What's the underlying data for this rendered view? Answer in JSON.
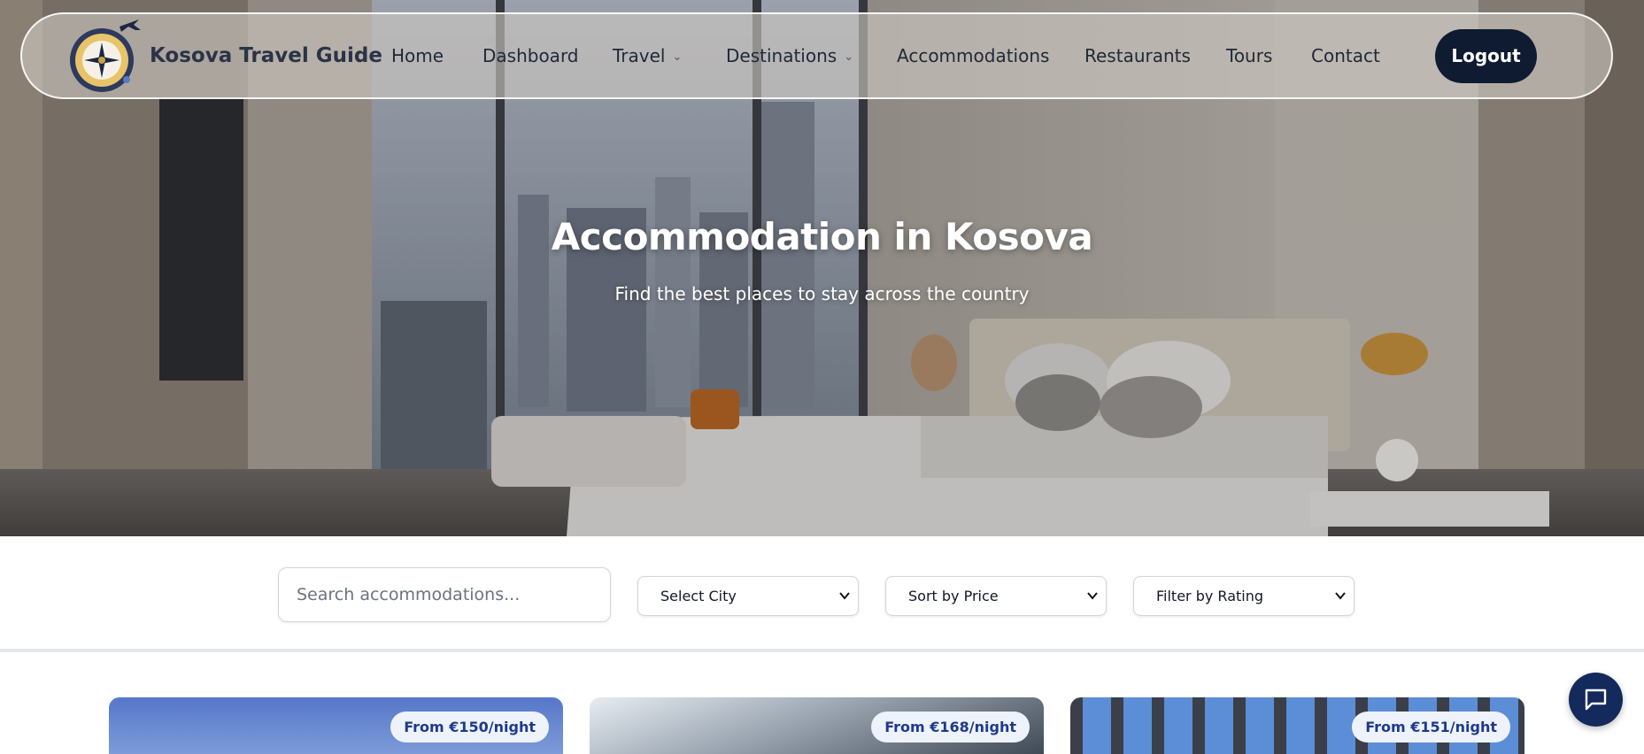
{
  "brand": {
    "name": "Kosova Travel Guide",
    "logo_icon": "compass-airplane-icon"
  },
  "nav": {
    "items": [
      {
        "label": "Home",
        "has_dropdown": false
      },
      {
        "label": "Dashboard",
        "has_dropdown": false
      },
      {
        "label": "Travel",
        "has_dropdown": true
      },
      {
        "label": "Destinations",
        "has_dropdown": true
      },
      {
        "label": "Accommodations",
        "has_dropdown": false
      },
      {
        "label": "Restaurants",
        "has_dropdown": false
      },
      {
        "label": "Tours",
        "has_dropdown": false
      },
      {
        "label": "Contact",
        "has_dropdown": false
      }
    ],
    "logout_label": "Logout"
  },
  "hero": {
    "title": "Accommodation in Kosova",
    "subtitle": "Find the best places to stay across the country"
  },
  "filters": {
    "search_placeholder": "Search accommodations...",
    "city_select": "Select City",
    "price_select": "Sort by Price",
    "rating_select": "Filter by Rating"
  },
  "cards": [
    {
      "price_label": "From €150/night"
    },
    {
      "price_label": "From €168/night"
    },
    {
      "price_label": "From €151/night"
    }
  ],
  "chat": {
    "icon": "chat-bubble-icon"
  },
  "colors": {
    "primary_dark": "#0f1b30",
    "chat_button": "#14295c",
    "badge_bg": "#eef2fb",
    "badge_text": "#1e3a8a"
  }
}
